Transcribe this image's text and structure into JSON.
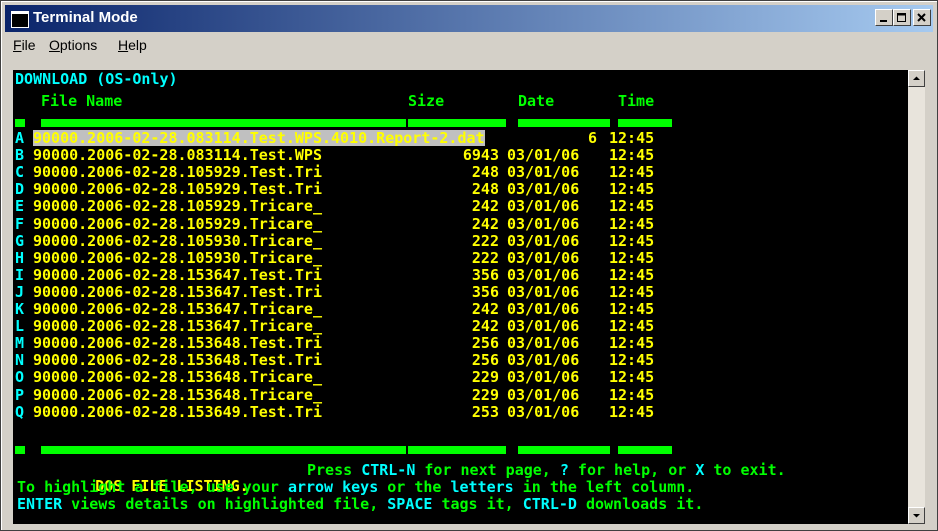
{
  "window": {
    "title": "Terminal Mode",
    "menu": [
      {
        "label": "File",
        "u": "F",
        "rest": "ile"
      },
      {
        "label": "Options",
        "u": "O",
        "rest": "ptions"
      },
      {
        "label": "Help",
        "u": "H",
        "rest": "elp"
      }
    ]
  },
  "terminal": {
    "heading": "DOWNLOAD (OS-Only)",
    "columns": {
      "name": "File Name",
      "size": "Size",
      "date": "Date",
      "time": "Time"
    },
    "rows": [
      {
        "letter": "A",
        "name": "90000.2006-02-28.083114.Test.WPS.4010.Report-2.dat",
        "size": "6",
        "date": "",
        "time": "12:45",
        "highlighted": true
      },
      {
        "letter": "B",
        "name": "90000.2006-02-28.083114.Test.WPS",
        "size": "6943",
        "date": "03/01/06",
        "time": "12:45"
      },
      {
        "letter": "C",
        "name": "90000.2006-02-28.105929.Test.Tri",
        "size": "248",
        "date": "03/01/06",
        "time": "12:45"
      },
      {
        "letter": "D",
        "name": "90000.2006-02-28.105929.Test.Tri",
        "size": "248",
        "date": "03/01/06",
        "time": "12:45"
      },
      {
        "letter": "E",
        "name": "90000.2006-02-28.105929.Tricare_",
        "size": "242",
        "date": "03/01/06",
        "time": "12:45"
      },
      {
        "letter": "F",
        "name": "90000.2006-02-28.105929.Tricare_",
        "size": "242",
        "date": "03/01/06",
        "time": "12:45"
      },
      {
        "letter": "G",
        "name": "90000.2006-02-28.105930.Tricare_",
        "size": "222",
        "date": "03/01/06",
        "time": "12:45"
      },
      {
        "letter": "H",
        "name": "90000.2006-02-28.105930.Tricare_",
        "size": "222",
        "date": "03/01/06",
        "time": "12:45"
      },
      {
        "letter": "I",
        "name": "90000.2006-02-28.153647.Test.Tri",
        "size": "356",
        "date": "03/01/06",
        "time": "12:45"
      },
      {
        "letter": "J",
        "name": "90000.2006-02-28.153647.Test.Tri",
        "size": "356",
        "date": "03/01/06",
        "time": "12:45"
      },
      {
        "letter": "K",
        "name": "90000.2006-02-28.153647.Tricare_",
        "size": "242",
        "date": "03/01/06",
        "time": "12:45"
      },
      {
        "letter": "L",
        "name": "90000.2006-02-28.153647.Tricare_",
        "size": "242",
        "date": "03/01/06",
        "time": "12:45"
      },
      {
        "letter": "M",
        "name": "90000.2006-02-28.153648.Test.Tri",
        "size": "256",
        "date": "03/01/06",
        "time": "12:45"
      },
      {
        "letter": "N",
        "name": "90000.2006-02-28.153648.Test.Tri",
        "size": "256",
        "date": "03/01/06",
        "time": "12:45"
      },
      {
        "letter": "O",
        "name": "90000.2006-02-28.153648.Tricare_",
        "size": "229",
        "date": "03/01/06",
        "time": "12:45"
      },
      {
        "letter": "P",
        "name": "90000.2006-02-28.153648.Tricare_",
        "size": "229",
        "date": "03/01/06",
        "time": "12:45"
      },
      {
        "letter": "Q",
        "name": "90000.2006-02-28.153649.Test.Tri",
        "size": "253",
        "date": "03/01/06",
        "time": "12:45"
      }
    ],
    "footer": {
      "listing": "DOS FILE LISTING.",
      "nav_pre": "Press ",
      "nav_key1": "CTRL-N",
      "nav_mid": " for next page, ",
      "nav_key2": "?",
      "nav_mid2": " for help, or ",
      "nav_key3": "X",
      "nav_post": " to exit.",
      "line2_pre": "To highlight a file, use your ",
      "line2_key": "arrow keys",
      "line2_mid": " or the ",
      "line2_key2": "letters",
      "line2_post": " in the left column.",
      "line3_key1": "ENTER",
      "line3_mid1": " views details on highlighted file, ",
      "line3_key2": "SPACE",
      "line3_mid2": " tags it, ",
      "line3_key3": "CTRL-D",
      "line3_post": " downloads it."
    }
  },
  "colors": {
    "background": "#000000",
    "text": "#ffff00",
    "accent_green": "#00ff00",
    "accent_cyan": "#00ffff",
    "highlight": "#c0c0c0"
  },
  "icons": [
    "app-icon",
    "minimize-icon",
    "maximize-icon",
    "close-icon",
    "scroll-up-icon",
    "scroll-down-icon"
  ]
}
